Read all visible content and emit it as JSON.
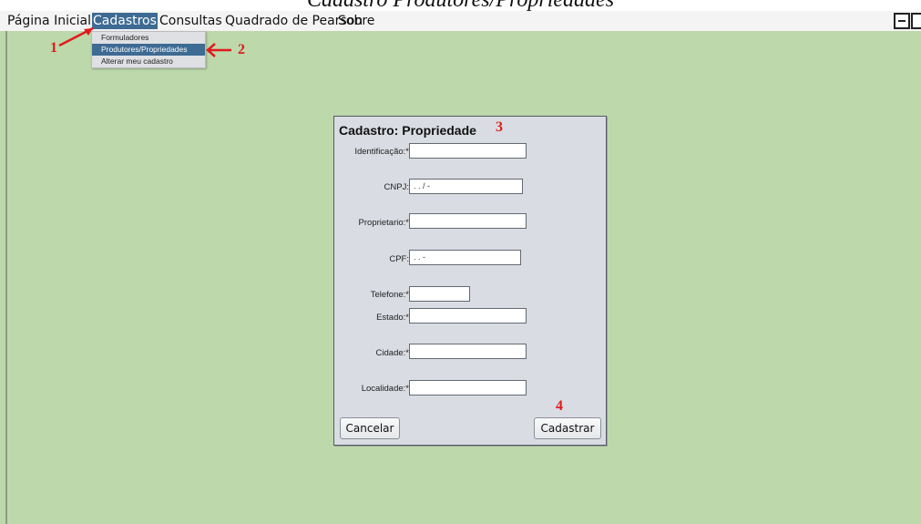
{
  "caption": "Cadastro Produtores/Propriedades",
  "menubar": {
    "items": [
      {
        "label": "Página Inicial"
      },
      {
        "label": "Cadastros"
      },
      {
        "label": "Consultas"
      },
      {
        "label": "Quadrado de Pearson"
      },
      {
        "label": "Sobre"
      }
    ],
    "active_index": 1
  },
  "dropdown": {
    "items": [
      {
        "label": "Formuladores"
      },
      {
        "label": "Produtores/Propriedades"
      },
      {
        "label": "Alterar meu cadastro"
      }
    ],
    "highlighted_index": 1
  },
  "form": {
    "title": "Cadastro: Propriedade",
    "fields": {
      "identificacao": {
        "label": "Identificação:*",
        "value": ""
      },
      "cnpj": {
        "label": "CNPJ:",
        "value": " .  .  /  -"
      },
      "proprietario": {
        "label": "Proprietario:*",
        "value": ""
      },
      "cpf": {
        "label": "CPF:",
        "value": " .  . -"
      },
      "telefone": {
        "label": "Telefone:*",
        "value": ""
      },
      "estado": {
        "label": "Estado:*",
        "value": ""
      },
      "cidade": {
        "label": "Cidade:*",
        "value": ""
      },
      "localidade": {
        "label": "Localidade:*",
        "value": ""
      }
    },
    "cancel_label": "Cancelar",
    "submit_label": "Cadastrar"
  },
  "annotations": {
    "a1": "1",
    "a2": "2",
    "a3": "3",
    "a4": "4"
  },
  "colors": {
    "desktop": "#bdd8aa",
    "menu_highlight": "#3d6b93",
    "annotation": "#e01b1b",
    "panel": "#d9dce2"
  },
  "icons": [
    "minimize-icon",
    "close-icon",
    "arrow-icon"
  ]
}
